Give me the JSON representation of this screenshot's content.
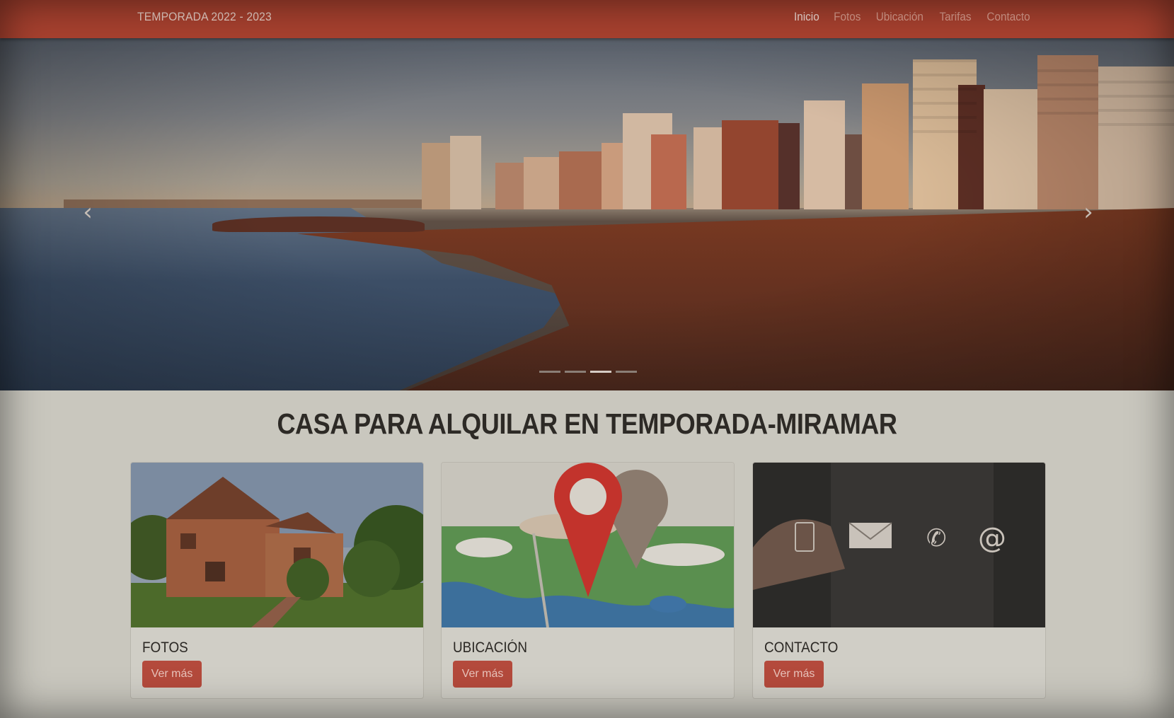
{
  "navbar": {
    "brand": "TEMPORADA 2022 - 2023",
    "links": [
      {
        "label": "Inicio",
        "active": true
      },
      {
        "label": "Fotos",
        "active": false
      },
      {
        "label": "Ubicación",
        "active": false
      },
      {
        "label": "Tarifas",
        "active": false
      },
      {
        "label": "Contacto",
        "active": false
      }
    ]
  },
  "carousel": {
    "prev_icon": "chevron-left-icon",
    "next_icon": "chevron-right-icon",
    "slide_count": 4,
    "active_slide": 3
  },
  "main": {
    "title": "CASA PARA ALQUILAR EN TEMPORADA-MIRAMAR",
    "cards": [
      {
        "title": "FOTOS",
        "button": "Ver más"
      },
      {
        "title": "UBICACIÓN",
        "button": "Ver más"
      },
      {
        "title": "CONTACTO",
        "button": "Ver más"
      }
    ]
  },
  "colors": {
    "navbar": "#a8412f",
    "button": "#b44a3c",
    "background": "#c9c7be"
  }
}
